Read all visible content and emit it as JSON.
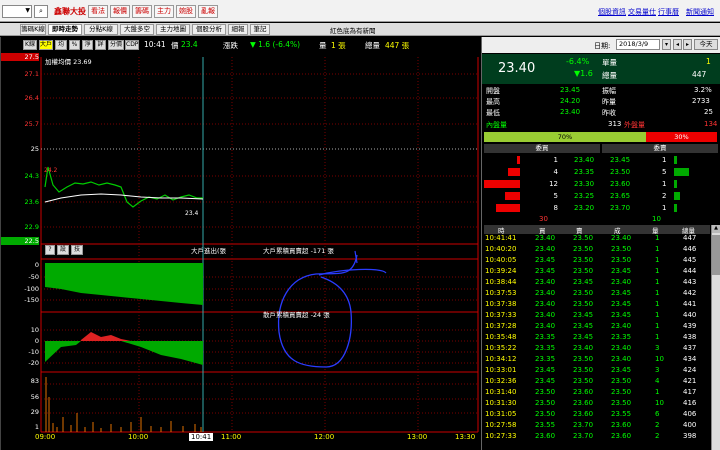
{
  "topbar": {
    "search_value": "",
    "brand": "鑫聯大投",
    "buttons": [
      "看法",
      "報價",
      "籌碼",
      "主力",
      "婉股",
      "亂報"
    ],
    "links": [
      "個股資訊",
      "交易量仕",
      "行事曆",
      "新聞通知"
    ]
  },
  "tabs": {
    "items": [
      "籌碼K線",
      "即時走勢",
      "分點K線",
      "大盤多空",
      "主力地圖",
      "個股分析",
      "細報",
      "筆記"
    ],
    "active": "即時走勢",
    "notice": "紅色底為有新聞"
  },
  "chartbar": {
    "buttons": [
      "K線",
      "大戶",
      "均",
      "%",
      "淨",
      "詳",
      "分價",
      "CDP"
    ],
    "time": "10:41",
    "price_label": "價",
    "price": "23.4",
    "change_label": "漲跌",
    "change": "▼ 1.6 (-6.4%)",
    "volume_label": "量",
    "volume": "1 張",
    "total_label": "總量",
    "total": "447 張"
  },
  "price_chart": {
    "legend": "加權均價 23.69",
    "y_labels": [
      "27.5",
      "27.1",
      "26.4",
      "25.7",
      "25",
      "24.3",
      "23.6",
      "22.9",
      "22.5"
    ],
    "open_marker": "24.2",
    "last_marker": "23.4"
  },
  "sub_panels": {
    "p1_buttons": [
      "?",
      "設",
      "技"
    ],
    "p1_title1": "大戶進出(張",
    "p1_title2": "大戶累積買賣超 -171 張",
    "p1_labels": [
      "0",
      "-50",
      "-100",
      "-150"
    ],
    "p2_title": "散戶累積買賣超 -24 張",
    "p2_labels": [
      "10",
      "0",
      "-10",
      "-20"
    ],
    "p3_labels": [
      "83",
      "56",
      "29",
      "1"
    ]
  },
  "x_axis": {
    "labels": [
      "09:00",
      "10:00",
      "10:41",
      "11:00",
      "12:00",
      "13:00",
      "13:30"
    ]
  },
  "right_panel": {
    "date_label": "日期:",
    "date": "2018/3/9",
    "today_btn": "今天",
    "big_price": "23.40",
    "pct": "-6.4%",
    "delta": "▼1.6",
    "single_label": "單量",
    "single": "1",
    "total_label": "總量",
    "total": "447",
    "stats": [
      {
        "k1": "開盤",
        "v1": "23.45",
        "k2": "振幅",
        "v2": "3.2%"
      },
      {
        "k1": "最高",
        "v1": "24.20",
        "k2": "昨量",
        "v2": "2733"
      },
      {
        "k1": "最低",
        "v1": "23.40",
        "k2": "昨收",
        "v2": "25"
      }
    ],
    "inner_label": "內盤量",
    "inner": "313",
    "outer_label": "外盤量",
    "outer": "134",
    "inner_pct": "70%",
    "outer_pct": "30%",
    "buy_header": "委買",
    "sell_header": "委賣",
    "book": [
      {
        "bq": "1",
        "bp": "23.40",
        "sp": "23.45",
        "sq": "1"
      },
      {
        "bq": "4",
        "bp": "23.35",
        "sp": "23.50",
        "sq": "5"
      },
      {
        "bq": "12",
        "bp": "23.30",
        "sp": "23.60",
        "sq": "1"
      },
      {
        "bq": "5",
        "bp": "23.25",
        "sp": "23.65",
        "sq": "2"
      },
      {
        "bq": "8",
        "bp": "23.20",
        "sp": "23.70",
        "sq": "1"
      }
    ],
    "book_total_buy": "30",
    "book_total_sell": "10",
    "tick_headers": [
      "時",
      "買",
      "賣",
      "成",
      "量",
      "總量"
    ],
    "ticks": [
      [
        "10:41:41",
        "23.40",
        "23.50",
        "23.40",
        "1",
        "447"
      ],
      [
        "10:40:20",
        "23.40",
        "23.50",
        "23.50",
        "1",
        "446"
      ],
      [
        "10:40:05",
        "23.45",
        "23.50",
        "23.50",
        "1",
        "445"
      ],
      [
        "10:39:24",
        "23.45",
        "23.50",
        "23.45",
        "1",
        "444"
      ],
      [
        "10:38:44",
        "23.40",
        "23.45",
        "23.40",
        "1",
        "443"
      ],
      [
        "10:37:53",
        "23.40",
        "23.50",
        "23.45",
        "1",
        "442"
      ],
      [
        "10:37:38",
        "23.40",
        "23.50",
        "23.45",
        "1",
        "441"
      ],
      [
        "10:37:33",
        "23.40",
        "23.45",
        "23.45",
        "1",
        "440"
      ],
      [
        "10:37:28",
        "23.40",
        "23.45",
        "23.40",
        "1",
        "439"
      ],
      [
        "10:35:48",
        "23.35",
        "23.45",
        "23.35",
        "1",
        "438"
      ],
      [
        "10:35:22",
        "23.35",
        "23.40",
        "23.40",
        "3",
        "437"
      ],
      [
        "10:34:12",
        "23.35",
        "23.50",
        "23.40",
        "10",
        "434"
      ],
      [
        "10:33:01",
        "23.45",
        "23.50",
        "23.45",
        "3",
        "424"
      ],
      [
        "10:32:36",
        "23.45",
        "23.50",
        "23.50",
        "4",
        "421"
      ],
      [
        "10:31:40",
        "23.50",
        "23.60",
        "23.50",
        "1",
        "417"
      ],
      [
        "10:31:30",
        "23.50",
        "23.60",
        "23.50",
        "10",
        "416"
      ],
      [
        "10:31:05",
        "23.50",
        "23.60",
        "23.55",
        "6",
        "406"
      ],
      [
        "10:27:58",
        "23.55",
        "23.70",
        "23.60",
        "2",
        "400"
      ],
      [
        "10:27:33",
        "23.60",
        "23.70",
        "23.60",
        "2",
        "398"
      ]
    ]
  },
  "colors": {
    "up": "#ff3333",
    "down": "#00dd00",
    "price": "#ffff00",
    "accent": "#00aaff"
  }
}
